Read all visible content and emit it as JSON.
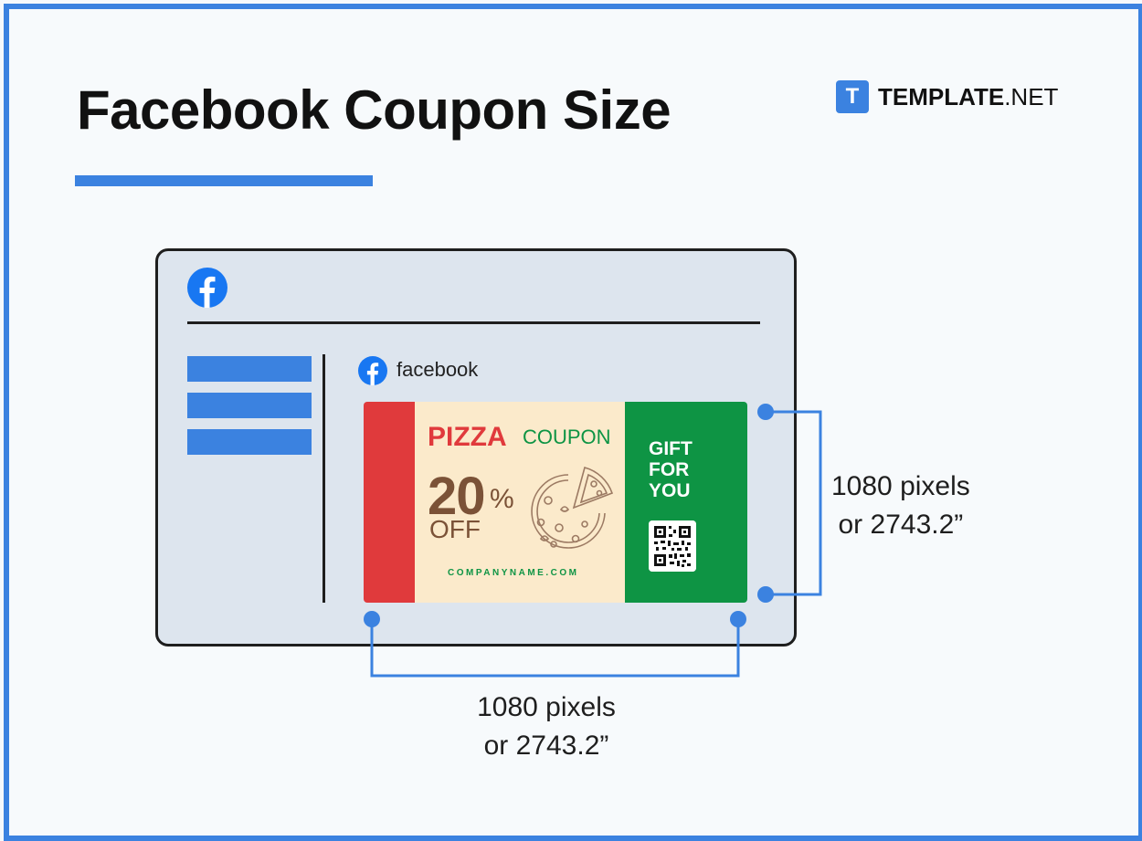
{
  "title": "Facebook Coupon Size",
  "brand": {
    "logo_letter": "T",
    "name_bold": "TEMPLATE",
    "name_rest": ".NET"
  },
  "feed": {
    "label": "facebook"
  },
  "coupon": {
    "headline": "PIZZA",
    "subheadline": "COUPON",
    "discount_value": "20",
    "discount_symbol": "%",
    "discount_suffix": "OFF",
    "website": "COMPANYNAME.COM",
    "gift_lines": [
      "GIFT",
      "FOR",
      "YOU"
    ]
  },
  "dimensions": {
    "height": {
      "line1": "1080 pixels",
      "line2": "or 2743.2”"
    },
    "width": {
      "line1": "1080 pixels",
      "line2": "or 2743.2”"
    }
  },
  "colors": {
    "accent": "#3b82e0",
    "coupon_red": "#e03a3c",
    "coupon_cream": "#fbeacb",
    "coupon_green": "#0e9444",
    "coupon_brown": "#7b5237",
    "facebook_blue": "#1877f2"
  },
  "icons": {
    "brand": "template-net-logo-icon",
    "social": "facebook-icon",
    "pizza": "pizza-icon",
    "qr": "qr-code-icon"
  }
}
